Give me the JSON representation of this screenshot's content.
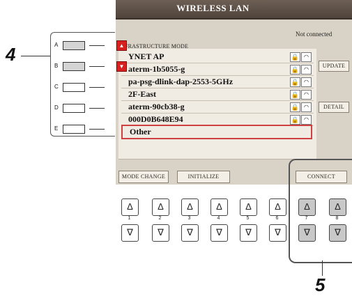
{
  "screen": {
    "title": "WIRELESS LAN",
    "status": "Not connected",
    "mode_label": "NFRASTRUCTURE MODE",
    "networks": [
      {
        "ssid": "YNET AP"
      },
      {
        "ssid": "aterm-1b5055-g"
      },
      {
        "ssid": "pa-psg-dlink-dap-2553-5GHz"
      },
      {
        "ssid": "2F-East"
      },
      {
        "ssid": "aterm-90cb38-g"
      },
      {
        "ssid": "000D0B648E94"
      },
      {
        "ssid": "Other"
      }
    ],
    "update_label": "UPDATE",
    "detail_label": "DETAIL",
    "mode_change_label": "MODE CHANGE",
    "initialize_label": "INITIALIZE",
    "connect_label": "CONNECT"
  },
  "left_panel": {
    "letters": [
      "A",
      "B",
      "C",
      "D",
      "E"
    ]
  },
  "hardware": {
    "numbers": [
      "1",
      "2",
      "3",
      "4",
      "5",
      "6",
      "7",
      "8"
    ],
    "up_glyph": "Δ",
    "down_glyph": "∇"
  },
  "callouts": {
    "step4": "4",
    "step5": "5"
  },
  "colors": {
    "title_bar": "#5e5047",
    "screen_bg": "#d9d2c6",
    "selected_border": "#d04040",
    "arrow_red": "#d82020"
  }
}
